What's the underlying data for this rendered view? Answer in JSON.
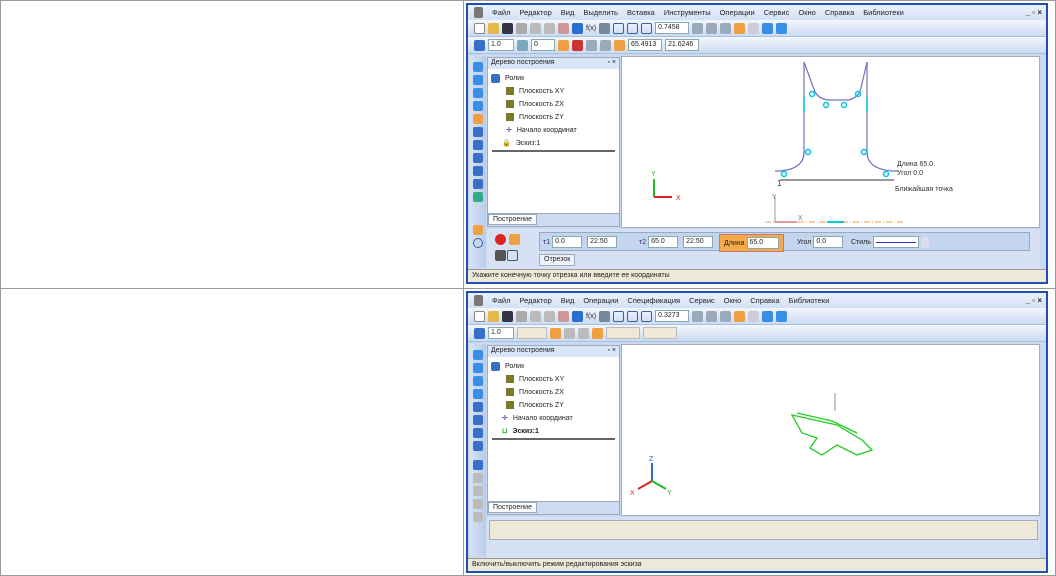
{
  "window1": {
    "menu": [
      "Файл",
      "Редактор",
      "Вид",
      "Выделить",
      "Вставка",
      "Инструменты",
      "Операции",
      "Сервис",
      "Окно",
      "Справка",
      "Библиотеки"
    ],
    "window_controls": "_ ▫ ×",
    "zoom": "0.7458",
    "step": "1.0",
    "layer": "0",
    "cursor_x": "65.4913",
    "cursor_y": "21.6246",
    "tree_title": "Дерево построения",
    "tree_root": "Ролик",
    "tree_items": [
      "Плоскость XY",
      "Плоскость ZX",
      "Плоскость ZY",
      "Начало координат",
      "Эскиз:1"
    ],
    "tree_tab": "Построение",
    "prop": {
      "p1_label": "т1",
      "p1_x": "0.0",
      "p1_y": "22.50",
      "p2_label": "т2",
      "p2_x": "65.0",
      "p2_y": "22.50",
      "length_label": "Длина",
      "length": "65.0",
      "angle_label": "Угол",
      "angle": "0.0",
      "style_label": "Стиль",
      "tab": "Отрезок"
    },
    "canvas_labels": {
      "length": "Длина 65.0",
      "angle": "Угол  0.0",
      "snap": "Ближайшая точка",
      "point": "1",
      "axis_x": "X",
      "axis_y": "Y"
    },
    "status": "Укажите конечную точку отрезка или введите ее координаты"
  },
  "window2": {
    "menu": [
      "Файл",
      "Редактор",
      "Вид",
      "Операции",
      "Спецификация",
      "Сервис",
      "Окно",
      "Справка",
      "Библиотеки"
    ],
    "window_controls": "_ ▫ ×",
    "zoom": "0.3273",
    "step": "1.0",
    "tree_title": "Дерево построения",
    "tree_root": "Ролик",
    "tree_items": [
      "Плоскость XY",
      "Плоскость ZX",
      "Плоскость ZY",
      "Начало координат",
      "Эскиз:1"
    ],
    "tree_tab": "Построение",
    "canvas_labels": {
      "axis_x": "X",
      "axis_y": "Y",
      "axis_z": "Z"
    },
    "status": "Включить/выключить режим редактирования эскиза"
  }
}
